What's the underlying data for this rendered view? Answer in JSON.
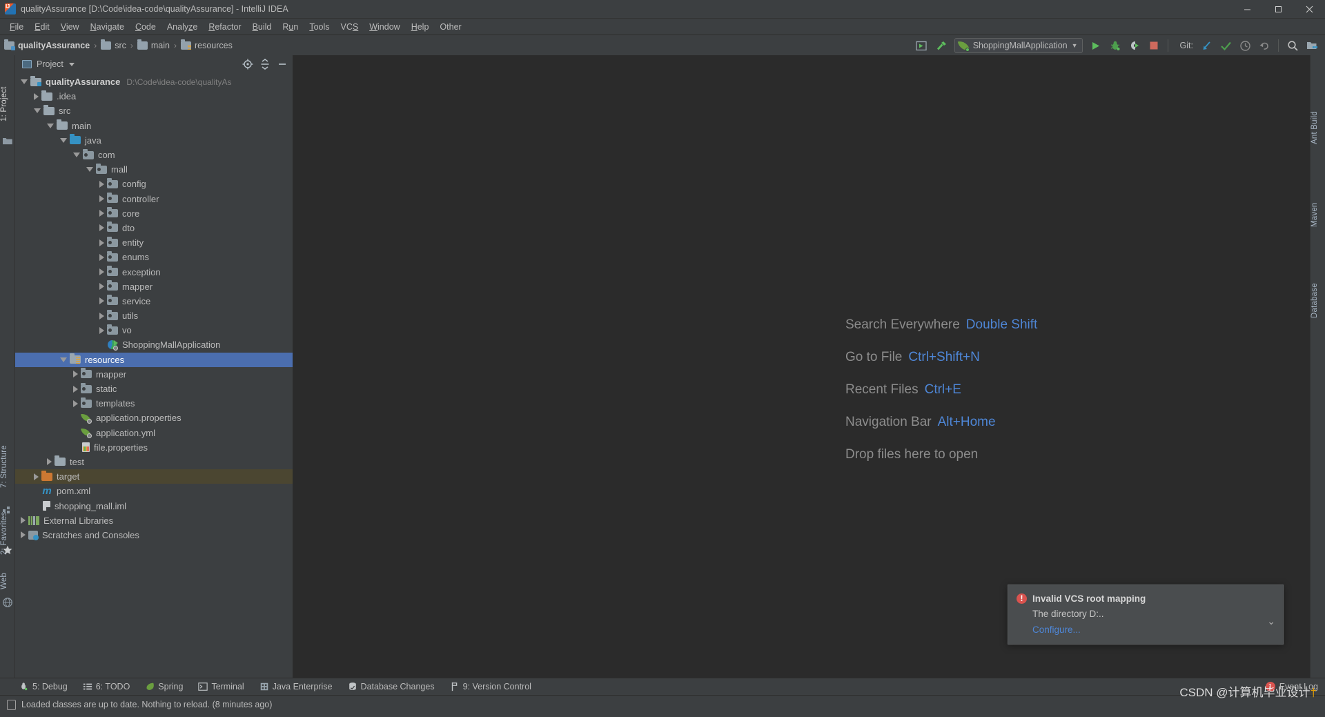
{
  "window": {
    "title": "qualityAssurance [D:\\Code\\idea-code\\qualityAssurance] - IntelliJ IDEA",
    "app_icon": "intellij-idea-icon",
    "minimize": "—",
    "maximize": "❐",
    "close": "✕"
  },
  "menubar": {
    "items": [
      {
        "label": "File"
      },
      {
        "label": "Edit"
      },
      {
        "label": "View"
      },
      {
        "label": "Navigate"
      },
      {
        "label": "Code"
      },
      {
        "label": "Analyze"
      },
      {
        "label": "Refactor"
      },
      {
        "label": "Build"
      },
      {
        "label": "Run"
      },
      {
        "label": "Tools"
      },
      {
        "label": "VCS"
      },
      {
        "label": "Window"
      },
      {
        "label": "Help"
      },
      {
        "label": "Other"
      }
    ]
  },
  "toolbar": {
    "breadcrumbs": [
      {
        "label": "qualityAssurance",
        "icon": "module-folder-icon",
        "bold": true
      },
      {
        "label": "src",
        "icon": "folder-icon",
        "bold": false
      },
      {
        "label": "main",
        "icon": "folder-icon",
        "bold": false
      },
      {
        "label": "resources",
        "icon": "resources-folder-icon",
        "bold": false
      }
    ],
    "separator": "›",
    "run_config": {
      "label": "ShoppingMallApplication",
      "icon": "spring-boot-icon",
      "dropdown": "▼"
    },
    "git_label": "Git:",
    "buttons": [
      {
        "name": "select-opened-file-button",
        "icon": "select-in-icon"
      },
      {
        "name": "build-project-button",
        "icon": "hammer-icon"
      },
      {
        "name": "run-button",
        "icon": "play-icon"
      },
      {
        "name": "debug-button",
        "icon": "bug-icon"
      },
      {
        "name": "run-with-coverage-button",
        "icon": "coverage-icon"
      },
      {
        "name": "stop-button",
        "icon": "stop-icon"
      },
      {
        "name": "update-project-button",
        "icon": "git-pull-icon"
      },
      {
        "name": "commit-button",
        "icon": "git-commit-check-icon"
      },
      {
        "name": "history-button",
        "icon": "clock-icon"
      },
      {
        "name": "rollback-button",
        "icon": "undo-icon"
      },
      {
        "name": "search-everywhere-button",
        "icon": "search-icon"
      },
      {
        "name": "project-structure-button",
        "icon": "project-structure-icon"
      }
    ]
  },
  "left_strip": {
    "items": [
      {
        "label": "1: Project",
        "active": true
      },
      {
        "label": "7: Structure",
        "active": false
      },
      {
        "label": "2: Favorites",
        "active": false
      },
      {
        "label": "Web",
        "active": false
      }
    ]
  },
  "right_strip": {
    "items": [
      {
        "label": "Ant Build"
      },
      {
        "label": "Maven"
      },
      {
        "label": "Database"
      }
    ]
  },
  "project_panel": {
    "title": "Project",
    "dropdown": "▼",
    "actions": [
      {
        "name": "select-opened-file-action",
        "icon": "target-icon"
      },
      {
        "name": "collapse-all-action",
        "icon": "collapse-all-icon"
      },
      {
        "name": "hide-panel-action",
        "icon": "minimize-icon"
      }
    ],
    "tree": [
      {
        "label": "qualityAssurance",
        "path": "D:\\Code\\idea-code\\qualityAs",
        "indent": 0,
        "twisty": "open",
        "icon": "module-folder-icon",
        "bold": true,
        "state": "normal"
      },
      {
        "label": ".idea",
        "path": "",
        "indent": 1,
        "twisty": "closed",
        "icon": "folder-icon",
        "bold": false,
        "state": "normal"
      },
      {
        "label": "src",
        "path": "",
        "indent": 1,
        "twisty": "open",
        "icon": "folder-icon",
        "bold": false,
        "state": "normal"
      },
      {
        "label": "main",
        "path": "",
        "indent": 2,
        "twisty": "open",
        "icon": "folder-icon",
        "bold": false,
        "state": "normal"
      },
      {
        "label": "java",
        "path": "",
        "indent": 3,
        "twisty": "open",
        "icon": "source-folder-icon",
        "bold": false,
        "state": "normal"
      },
      {
        "label": "com",
        "path": "",
        "indent": 4,
        "twisty": "open",
        "icon": "package-icon",
        "bold": false,
        "state": "normal"
      },
      {
        "label": "mall",
        "path": "",
        "indent": 5,
        "twisty": "open",
        "icon": "package-icon",
        "bold": false,
        "state": "normal"
      },
      {
        "label": "config",
        "path": "",
        "indent": 6,
        "twisty": "closed",
        "icon": "package-icon",
        "bold": false,
        "state": "normal"
      },
      {
        "label": "controller",
        "path": "",
        "indent": 6,
        "twisty": "closed",
        "icon": "package-icon",
        "bold": false,
        "state": "normal"
      },
      {
        "label": "core",
        "path": "",
        "indent": 6,
        "twisty": "closed",
        "icon": "package-icon",
        "bold": false,
        "state": "normal"
      },
      {
        "label": "dto",
        "path": "",
        "indent": 6,
        "twisty": "closed",
        "icon": "package-icon",
        "bold": false,
        "state": "normal"
      },
      {
        "label": "entity",
        "path": "",
        "indent": 6,
        "twisty": "closed",
        "icon": "package-icon",
        "bold": false,
        "state": "normal"
      },
      {
        "label": "enums",
        "path": "",
        "indent": 6,
        "twisty": "closed",
        "icon": "package-icon",
        "bold": false,
        "state": "normal"
      },
      {
        "label": "exception",
        "path": "",
        "indent": 6,
        "twisty": "closed",
        "icon": "package-icon",
        "bold": false,
        "state": "normal"
      },
      {
        "label": "mapper",
        "path": "",
        "indent": 6,
        "twisty": "closed",
        "icon": "package-icon",
        "bold": false,
        "state": "normal"
      },
      {
        "label": "service",
        "path": "",
        "indent": 6,
        "twisty": "closed",
        "icon": "package-icon",
        "bold": false,
        "state": "normal"
      },
      {
        "label": "utils",
        "path": "",
        "indent": 6,
        "twisty": "closed",
        "icon": "package-icon",
        "bold": false,
        "state": "normal"
      },
      {
        "label": "vo",
        "path": "",
        "indent": 6,
        "twisty": "closed",
        "icon": "package-icon",
        "bold": false,
        "state": "normal"
      },
      {
        "label": "ShoppingMallApplication",
        "path": "",
        "indent": 6,
        "twisty": "none",
        "icon": "spring-boot-class-icon",
        "bold": false,
        "state": "normal"
      },
      {
        "label": "resources",
        "path": "",
        "indent": 3,
        "twisty": "open",
        "icon": "resources-folder-icon",
        "bold": false,
        "state": "selected"
      },
      {
        "label": "mapper",
        "path": "",
        "indent": 4,
        "twisty": "closed",
        "icon": "package-icon",
        "bold": false,
        "state": "normal"
      },
      {
        "label": "static",
        "path": "",
        "indent": 4,
        "twisty": "closed",
        "icon": "package-icon",
        "bold": false,
        "state": "normal"
      },
      {
        "label": "templates",
        "path": "",
        "indent": 4,
        "twisty": "closed",
        "icon": "package-icon",
        "bold": false,
        "state": "normal"
      },
      {
        "label": "application.properties",
        "path": "",
        "indent": 4,
        "twisty": "none",
        "icon": "spring-config-icon",
        "bold": false,
        "state": "normal"
      },
      {
        "label": "application.yml",
        "path": "",
        "indent": 4,
        "twisty": "none",
        "icon": "spring-config-icon",
        "bold": false,
        "state": "normal"
      },
      {
        "label": "file.properties",
        "path": "",
        "indent": 4,
        "twisty": "none",
        "icon": "properties-file-icon",
        "bold": false,
        "state": "normal"
      },
      {
        "label": "test",
        "path": "",
        "indent": 2,
        "twisty": "closed",
        "icon": "folder-icon",
        "bold": false,
        "state": "normal"
      },
      {
        "label": "target",
        "path": "",
        "indent": 1,
        "twisty": "closed",
        "icon": "excluded-folder-icon",
        "bold": false,
        "state": "warning"
      },
      {
        "label": "pom.xml",
        "path": "",
        "indent": 1,
        "twisty": "none",
        "icon": "maven-icon",
        "bold": false,
        "state": "normal"
      },
      {
        "label": "shopping_mall.iml",
        "path": "",
        "indent": 1,
        "twisty": "none",
        "icon": "iml-file-icon",
        "bold": false,
        "state": "normal"
      },
      {
        "label": "External Libraries",
        "path": "",
        "indent": 0,
        "twisty": "closed",
        "icon": "libraries-icon",
        "bold": false,
        "state": "normal"
      },
      {
        "label": "Scratches and Consoles",
        "path": "",
        "indent": 0,
        "twisty": "closed",
        "icon": "scratches-icon",
        "bold": false,
        "state": "normal"
      }
    ]
  },
  "editor": {
    "tips": [
      {
        "action": "Search Everywhere",
        "shortcut": "Double Shift"
      },
      {
        "action": "Go to File",
        "shortcut": "Ctrl+Shift+N"
      },
      {
        "action": "Recent Files",
        "shortcut": "Ctrl+E"
      },
      {
        "action": "Navigation Bar",
        "shortcut": "Alt+Home"
      },
      {
        "action": "Drop files here to open",
        "shortcut": ""
      }
    ]
  },
  "notification": {
    "icon": "error-icon",
    "title": "Invalid VCS root mapping",
    "body": "The directory D:..",
    "link": "Configure...",
    "expand": "⌄"
  },
  "bottom_bar": {
    "items": [
      {
        "label": "5: Debug",
        "icon": "debug-icon",
        "underline": "5"
      },
      {
        "label": "6: TODO",
        "icon": "todo-icon",
        "underline": "6"
      },
      {
        "label": "Spring",
        "icon": "spring-icon",
        "underline": ""
      },
      {
        "label": "Terminal",
        "icon": "terminal-icon",
        "underline": ""
      },
      {
        "label": "Java Enterprise",
        "icon": "java-ee-icon",
        "underline": ""
      },
      {
        "label": "Database Changes",
        "icon": "database-icon",
        "underline": ""
      },
      {
        "label": "9: Version Control",
        "icon": "version-control-icon",
        "underline": "9"
      }
    ],
    "event_log": {
      "label": "Event Log",
      "badge": "1",
      "icon": "event-log-icon"
    }
  },
  "statusbar": {
    "icon": "status-message-icon",
    "message": "Loaded classes are up to date. Nothing to reload. (8 minutes ago)"
  },
  "watermark": {
    "text": "CSDN @计算机毕业设计",
    "suffix": "†"
  },
  "colors": {
    "panel_bg": "#3c3f41",
    "editor_bg": "#2b2b2b",
    "selection": "#4b6eaf",
    "warning_row": "#4b4631",
    "link": "#4e86d6",
    "text": "#bbbbbb",
    "muted": "#808080",
    "error": "#d9534f",
    "green": "#5dbd5d"
  }
}
